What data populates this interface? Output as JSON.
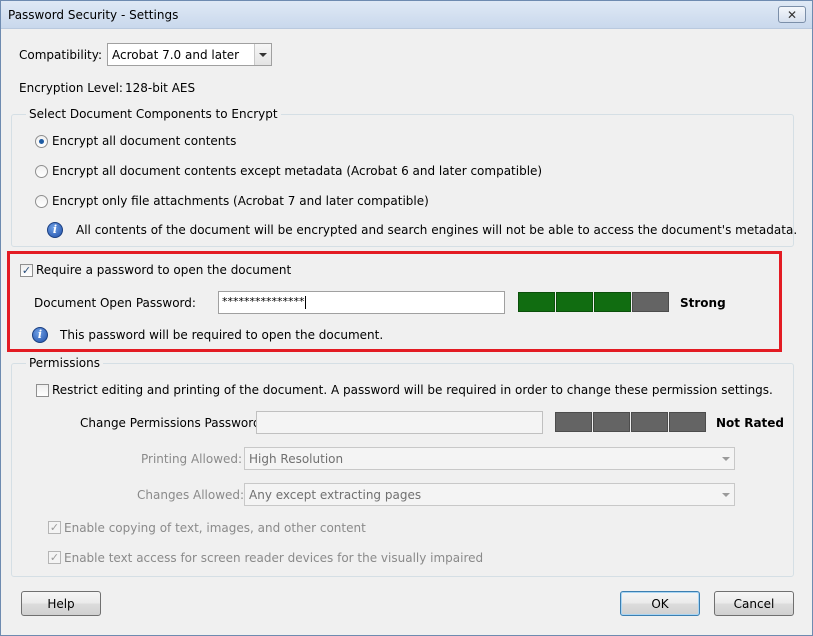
{
  "window": {
    "title": "Password Security - Settings",
    "close_label": "✕"
  },
  "compatibility": {
    "label": "Compatibility:",
    "value": "Acrobat 7.0 and later"
  },
  "encryption": {
    "label": "Encryption  Level:",
    "value": "128-bit AES"
  },
  "components": {
    "title": "Select Document Components to Encrypt",
    "options": [
      {
        "label": "Encrypt all document contents",
        "selected": true
      },
      {
        "label": "Encrypt all document contents except metadata (Acrobat 6 and later compatible)",
        "selected": false
      },
      {
        "label": "Encrypt only file attachments (Acrobat 7 and later compatible)",
        "selected": false
      }
    ],
    "info_text": "All contents of the document will be encrypted and search engines will not be able to access the document's metadata."
  },
  "open_password": {
    "checkbox_label": "Require a password to open the document",
    "checked": true,
    "field_label": "Document Open Password:",
    "value": "***************",
    "strength": "Strong",
    "strength_filled_segments": 3,
    "strength_total_segments": 4,
    "info_text": "This password will be required to open the document."
  },
  "permissions": {
    "title": "Permissions",
    "restrict_label": "Restrict editing and printing of the document. A password will be required in order to change these permission settings.",
    "restrict_checked": false,
    "password_label": "Change Permissions Password:",
    "password_value": "",
    "strength": "Not Rated",
    "printing_label": "Printing Allowed:",
    "printing_value": "High Resolution",
    "changes_label": "Changes Allowed:",
    "changes_value": "Any except extracting pages",
    "copy_label": "Enable copying of text, images, and other content",
    "copy_checked": true,
    "screen_reader_label": "Enable text access for screen reader devices for the visually impaired",
    "screen_reader_checked": true
  },
  "buttons": {
    "help": "Help",
    "ok": "OK",
    "cancel": "Cancel"
  },
  "colors": {
    "highlight_box": "#e31b23",
    "strength_strong": "#116d11",
    "strength_empty": "#646464"
  }
}
